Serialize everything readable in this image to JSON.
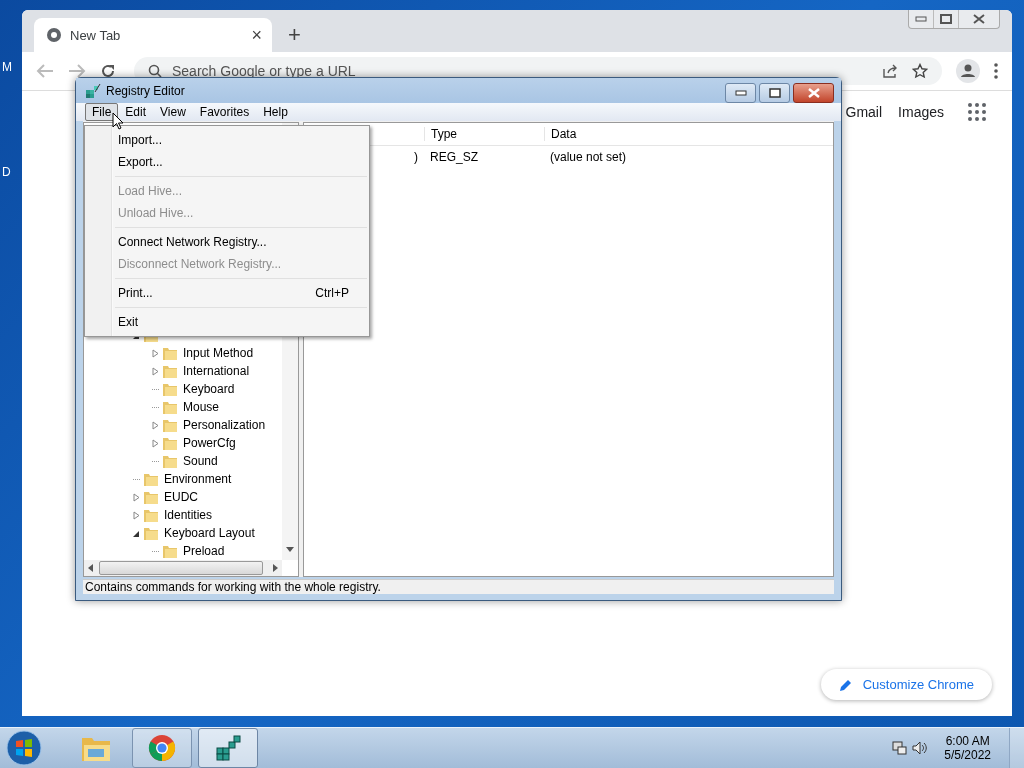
{
  "desktop": {
    "edge_labels": [
      "M",
      "D"
    ]
  },
  "browser": {
    "tabs": [
      {
        "title": "New Tab",
        "close": "×",
        "selected": true
      }
    ],
    "new_tab": "+",
    "omnibox": {
      "placeholder": "Search Google or type a URL"
    },
    "links": [
      "Gmail",
      "Images"
    ],
    "customize": "Customize Chrome"
  },
  "regedit": {
    "title": "Registry Editor",
    "menus": [
      {
        "label": "File",
        "selected": true
      },
      {
        "label": "Edit",
        "selected": false
      },
      {
        "label": "View",
        "selected": false
      },
      {
        "label": "Favorites",
        "selected": false
      },
      {
        "label": "Help",
        "selected": false
      }
    ],
    "file_menu": [
      {
        "kind": "item",
        "label": "Import...",
        "disabled": false
      },
      {
        "kind": "item",
        "label": "Export...",
        "disabled": false
      },
      {
        "kind": "separator"
      },
      {
        "kind": "item",
        "label": "Load Hive...",
        "disabled": true
      },
      {
        "kind": "item",
        "label": "Unload Hive...",
        "disabled": true
      },
      {
        "kind": "separator"
      },
      {
        "kind": "item",
        "label": "Connect Network Registry...",
        "disabled": false
      },
      {
        "kind": "item",
        "label": "Disconnect Network Registry...",
        "disabled": true
      },
      {
        "kind": "separator"
      },
      {
        "kind": "item",
        "label": "Print...",
        "shortcut": "Ctrl+P",
        "disabled": false
      },
      {
        "kind": "separator"
      },
      {
        "kind": "item",
        "label": "Exit",
        "disabled": false
      }
    ],
    "tree": [
      {
        "expandable": true,
        "expanded": true,
        "children": [
          {
            "label": "Input Method",
            "expandable": true,
            "expanded": false
          },
          {
            "label": "International",
            "expandable": true,
            "expanded": false
          },
          {
            "label": "Keyboard",
            "expandable": false
          },
          {
            "label": "Mouse",
            "expandable": false
          },
          {
            "label": "Personalization",
            "expandable": true,
            "expanded": false
          },
          {
            "label": "PowerCfg",
            "expandable": true,
            "expanded": false
          },
          {
            "label": "Sound",
            "expandable": false
          }
        ]
      },
      {
        "label": "Environment",
        "expandable": false
      },
      {
        "label": "EUDC",
        "expandable": true,
        "expanded": false
      },
      {
        "label": "Identities",
        "expandable": true,
        "expanded": false
      },
      {
        "label": "Keyboard Layout",
        "expandable": true,
        "expanded": true,
        "children": [
          {
            "label": "Preload",
            "expandable": false
          }
        ]
      }
    ],
    "columns": [
      "Type",
      "Data"
    ],
    "rows": [
      {
        "name": ")",
        "type": "REG_SZ",
        "data": "(value not set)"
      }
    ],
    "status": "Contains commands for working with the whole registry."
  },
  "taskbar": {
    "apps": [
      {
        "kind": "explorer",
        "active": false
      },
      {
        "kind": "chrome",
        "active": false
      },
      {
        "kind": "regedit",
        "active": true
      }
    ],
    "time": "6:00 AM",
    "date": "5/5/2022"
  }
}
